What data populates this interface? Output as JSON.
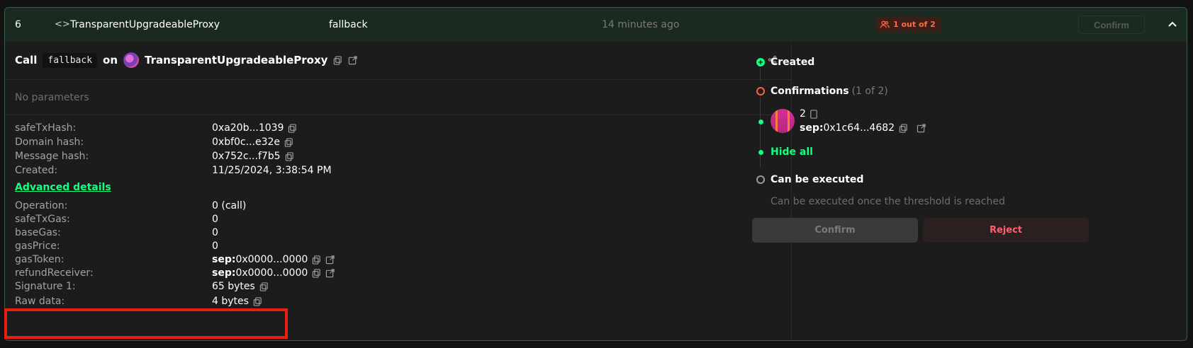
{
  "header": {
    "nonce": "6",
    "contract": "TransparentUpgradeableProxy",
    "method": "fallback",
    "time": "14 minutes ago",
    "badge": "1 out of 2",
    "confirm_label": "Confirm"
  },
  "call": {
    "call_label": "Call",
    "method": "fallback",
    "on_label": "on",
    "contract": "TransparentUpgradeableProxy"
  },
  "no_params": "No parameters",
  "details": [
    {
      "label": "safeTxHash:",
      "value": "0xa20b...1039"
    },
    {
      "label": "Domain hash:",
      "value": "0xbf0c...e32e"
    },
    {
      "label": "Message hash:",
      "value": "0x752c...f7b5"
    },
    {
      "label": "Created:",
      "value": "11/25/2024, 3:38:54 PM"
    }
  ],
  "advanced_label": "Advanced details",
  "advanced": {
    "operation": {
      "label": "Operation:",
      "value": "0 (call)"
    },
    "safeTxGas": {
      "label": "safeTxGas:",
      "value": "0"
    },
    "baseGas": {
      "label": "baseGas:",
      "value": "0"
    },
    "gasPrice": {
      "label": "gasPrice:",
      "value": "0"
    },
    "gasToken": {
      "label": "gasToken:",
      "prefix": "sep:",
      "value": "0x0000...0000"
    },
    "refundReceiver": {
      "label": "refundReceiver:",
      "prefix": "sep:",
      "value": "0x0000...0000"
    },
    "signature": {
      "label": "Signature 1:",
      "value": "65 bytes"
    },
    "rawData": {
      "label": "Raw data:",
      "value": "4 bytes"
    }
  },
  "timeline": {
    "created": "Created",
    "confirmations": "Confirmations",
    "confirmations_count": "(1 of 2)",
    "signer_index": "2",
    "signer_prefix": "sep:",
    "signer_address": "0x1c64...4682",
    "hide_all": "Hide all",
    "can_execute": "Can be executed",
    "can_execute_note": "Can be executed once the threshold is reached"
  },
  "actions": {
    "confirm": "Confirm",
    "reject": "Reject"
  },
  "colors": {
    "accent_green": "#12ff80",
    "warning_orange": "#ff6a43",
    "reject_red": "#ff5f72",
    "highlight_red": "#e82010"
  }
}
